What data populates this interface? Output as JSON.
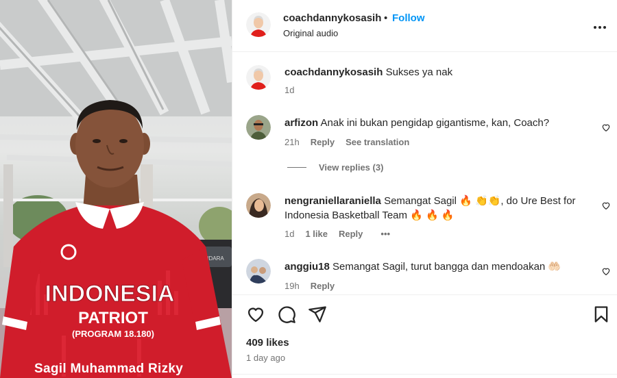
{
  "post": {
    "username": "coachdannykosasih",
    "separator": "•",
    "follow_label": "Follow",
    "audio": "Original audio"
  },
  "media": {
    "caption": "Sagil Muhammad Rizky",
    "shirt_line1": "INDONESIA",
    "shirt_line2": "PATRIOT",
    "shirt_line3": "(PROGRAM 18.180)",
    "car_plate": "BANDARA"
  },
  "comments": [
    {
      "username": "coachdannykosasih",
      "text": "Sukses ya nak",
      "time": "1d"
    },
    {
      "username": "arfizon",
      "text": "Anak ini bukan pengidap gigantisme, kan, Coach?",
      "time": "21h",
      "reply_label": "Reply",
      "translate_label": "See translation",
      "view_replies": "View replies (3)"
    },
    {
      "username": "nengraniellaraniella",
      "text_line1": "Semangat Sagil 🔥 👏👏, do Ure Best for",
      "text_line2": "Indonesia Basketball Team 🔥 🔥 🔥",
      "time": "1d",
      "likes": "1 like",
      "reply_label": "Reply",
      "more": "•••"
    },
    {
      "username": "anggiu18",
      "text": "Semangat Sagil, turut bangga dan mendoakan 🤲🏻",
      "time": "19h",
      "reply_label": "Reply"
    }
  ],
  "footer": {
    "likes": "409 likes",
    "time_ago": "1 day ago"
  },
  "icons": {
    "like": "heart-icon",
    "comment": "comment-icon",
    "share": "share-icon",
    "save": "bookmark-icon",
    "more": "more-icon"
  },
  "colors": {
    "link": "#0095f6",
    "text": "#262626",
    "secondary": "#737373",
    "jersey": "#d01d2b"
  }
}
